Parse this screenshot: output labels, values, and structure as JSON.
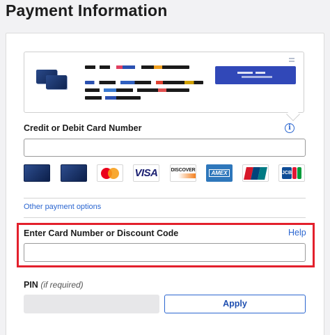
{
  "page": {
    "title": "Payment Information"
  },
  "card_section": {
    "label": "Credit or Debit Card Number",
    "info_icon": "info-icon",
    "input_value": "",
    "card_logos": [
      {
        "name": "gift-card-dark",
        "label": ""
      },
      {
        "name": "gift-card-dark",
        "label": ""
      },
      {
        "name": "mastercard",
        "label": ""
      },
      {
        "name": "visa",
        "label": "VISA"
      },
      {
        "name": "discover",
        "label": "DISCOVER"
      },
      {
        "name": "amex",
        "label": "AMEX"
      },
      {
        "name": "unionpay",
        "label": ""
      },
      {
        "name": "jcb",
        "label": "JCB"
      }
    ]
  },
  "other_payment_link": "Other payment options",
  "discount_section": {
    "label": "Enter Card Number or Discount Code",
    "help_link": "Help",
    "input_value": ""
  },
  "pin_section": {
    "label": "PIN",
    "hint": "(if required)",
    "input_value": "",
    "apply_label": "Apply"
  },
  "colors": {
    "accent": "#2b66d0",
    "highlight": "#e3202c",
    "promo_button": "#3148b8"
  }
}
